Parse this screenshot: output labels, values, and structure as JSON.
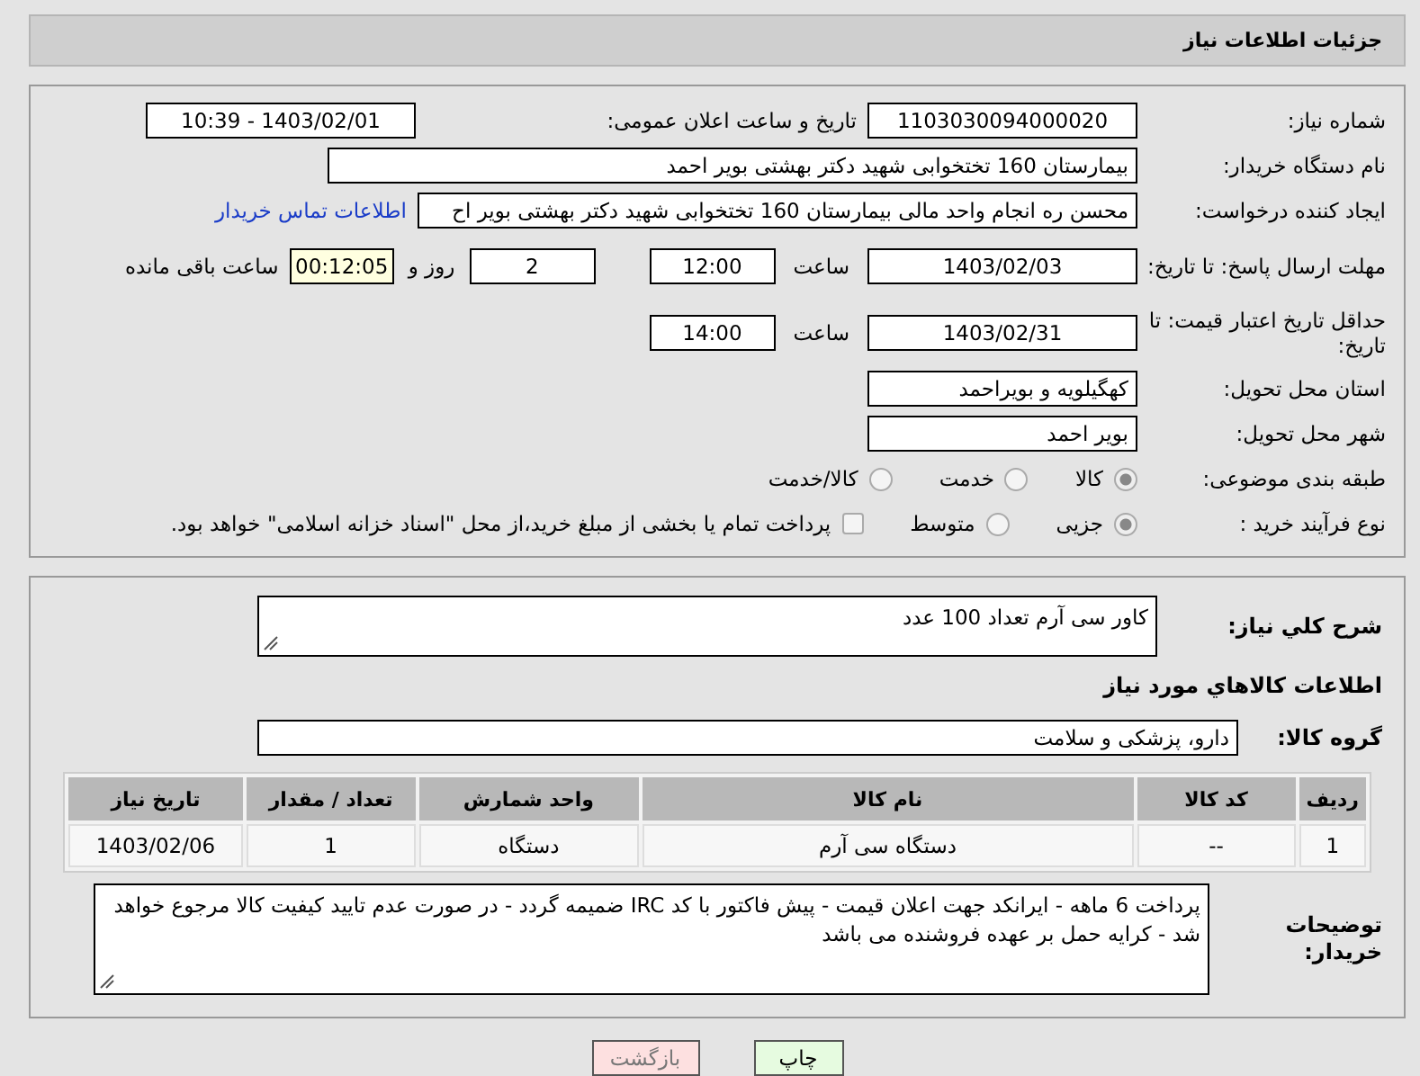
{
  "title": "جزئیات اطلاعات نیاز",
  "need_number": {
    "label": "شماره نیاز:",
    "value": "1103030094000020"
  },
  "announce": {
    "label": "تاریخ و ساعت اعلان عمومی:",
    "value": "1403/02/01 - 10:39"
  },
  "buyer": {
    "label": "نام دستگاه خریدار:",
    "value": "بیمارستان 160 تختخوابی شهید دکتر بهشتی بویر احمد"
  },
  "creator": {
    "label": "ایجاد کننده درخواست:",
    "value": "محسن ره انجام واحد مالی بیمارستان 160 تختخوابی شهید دکتر بهشتی بویر اح",
    "link": "اطلاعات تماس خریدار"
  },
  "deadline": {
    "label": "مهلت ارسال پاسخ: تا تاریخ:",
    "date": "1403/02/03",
    "time_label": "ساعت",
    "time": "12:00",
    "days": "2",
    "days_label": "روز و",
    "remaining": "00:12:05",
    "remaining_label": "ساعت باقی مانده"
  },
  "validity": {
    "label": "حداقل تاریخ اعتبار قیمت: تا تاریخ:",
    "date": "1403/02/31",
    "time_label": "ساعت",
    "time": "14:00"
  },
  "province": {
    "label": "استان محل تحویل:",
    "value": "کهگیلویه و بویراحمد"
  },
  "city": {
    "label": "شهر محل تحویل:",
    "value": "بویر احمد"
  },
  "category": {
    "label": "طبقه بندی موضوعی:",
    "options": [
      {
        "label": "کالا",
        "selected": true
      },
      {
        "label": "خدمت",
        "selected": false
      },
      {
        "label": "کالا/خدمت",
        "selected": false
      }
    ]
  },
  "process": {
    "label": "نوع فرآیند خرید :",
    "options": [
      {
        "label": "جزیی",
        "selected": true
      },
      {
        "label": "متوسط",
        "selected": false
      }
    ],
    "treasury": {
      "label": "پرداخت تمام یا بخشی از مبلغ خرید،از محل \"اسناد خزانه اسلامی\" خواهد بود.",
      "checked": false
    }
  },
  "description": {
    "label": "شرح کلي نياز:",
    "value": "کاور سی آرم تعداد 100 عدد"
  },
  "goods_heading": "اطلاعات كالاهاي مورد نياز",
  "goods_group": {
    "label": "گروه کالا:",
    "value": "دارو، پزشکی و سلامت"
  },
  "table": {
    "columns": [
      "ردیف",
      "کد کالا",
      "نام کالا",
      "واحد شمارش",
      "تعداد / مقدار",
      "تاریخ نیاز"
    ],
    "rows": [
      [
        "1",
        "--",
        "دستگاه سی آرم",
        "دستگاه",
        "1",
        "1403/02/06"
      ]
    ]
  },
  "buyer_notes": {
    "label": "توضیحات خریدار:",
    "value": "پرداخت 6 ماهه - ایرانکد جهت اعلان قیمت - پیش فاکتور با کد IRC ضمیمه گردد - در صورت عدم تایید کیفیت کالا مرجوع خواهد شد - کرایه حمل بر عهده فروشنده می باشد"
  },
  "buttons": [
    {
      "label": "چاپ",
      "kind": "print"
    },
    {
      "label": "بازگشت",
      "kind": "back"
    }
  ]
}
